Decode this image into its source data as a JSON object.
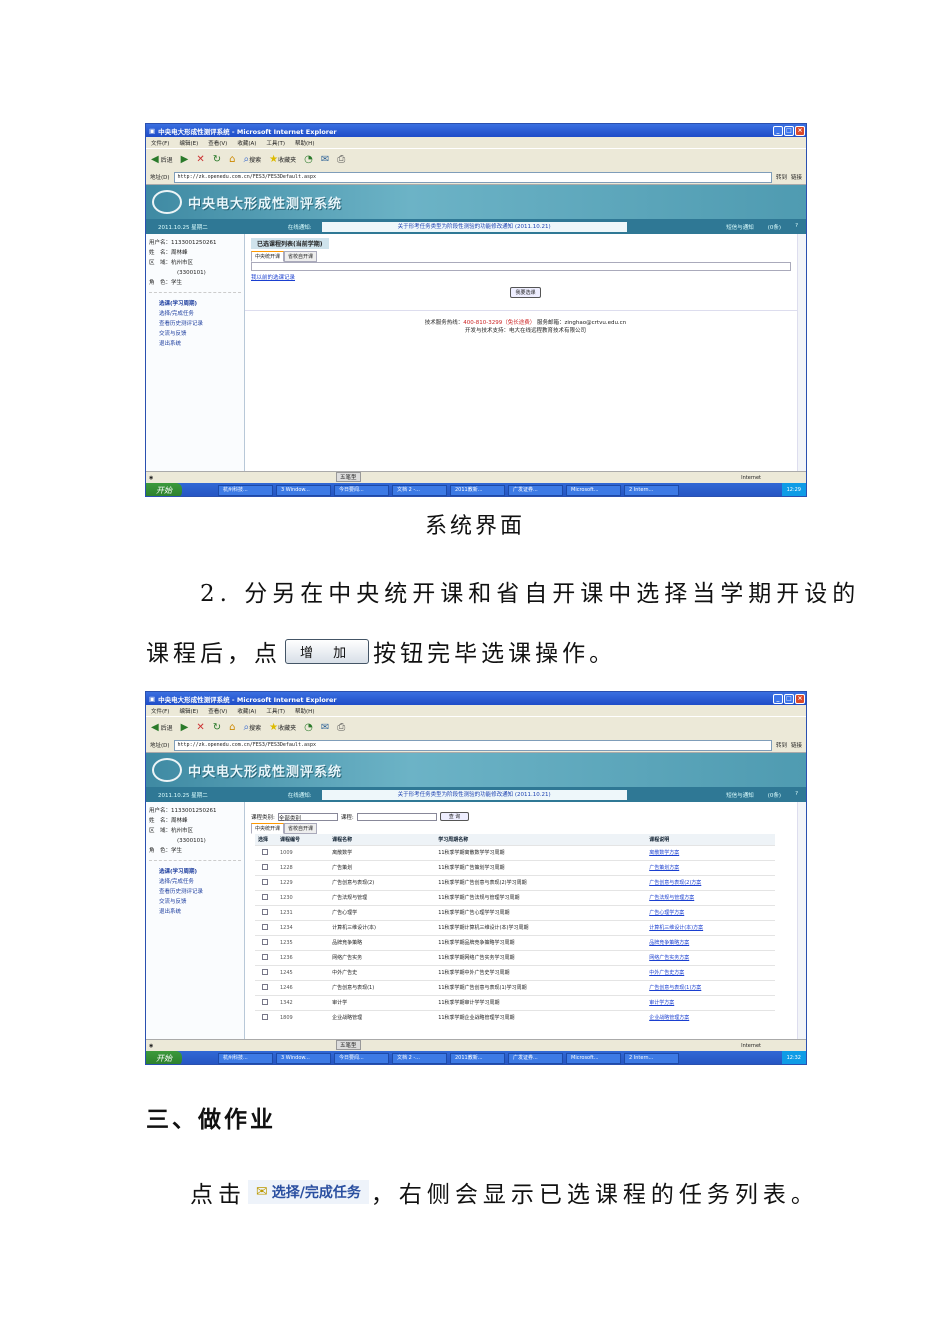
{
  "browser": {
    "window_title": "中央电大形成性测评系统 - Microsoft Internet Explorer",
    "menu": [
      "文件(F)",
      "编辑(E)",
      "查看(V)",
      "收藏(A)",
      "工具(T)",
      "帮助(H)"
    ],
    "toolbar": {
      "back": "后退",
      "search": "搜索",
      "favorites": "收藏夹"
    },
    "address_label": "地址(D)",
    "url": "http://zk.openedu.com.cn/FES3/FES3Default.aspx",
    "go": "转到",
    "links": "链接",
    "status_zone": "Internet",
    "ime": "五笔型"
  },
  "taskbar": {
    "start": "开始",
    "items": [
      "杭州科技...",
      "3 Window...",
      "今日要闻...",
      "文档 2 -...",
      "2011教新...",
      "广发证券...",
      "Microsoft...",
      "2 Intern..."
    ],
    "time1": "12:29",
    "time2": "12:32"
  },
  "app": {
    "system_title": "中央电大形成性测评系统",
    "date": "2011.10.25 星期二",
    "notice_label": "在线通知:",
    "notice": "关于形考任务类型为阶段性测验的功能修改通知 (2011.10.21)",
    "messages": "短信与通知",
    "msg_count": "(0条)",
    "user": {
      "username_label": "用户名：",
      "username": "1133001250261",
      "name_label": "姓　名：",
      "name": "周林峰",
      "region_label": "区　域：",
      "region": "杭州市区",
      "region_code": "(3300101)",
      "role_label": "角　色：",
      "role": "学生"
    },
    "nav": [
      "选课(学习周期)",
      "选择/完成任务",
      "查看历史测评记录",
      "交流与反馈",
      "退出系统"
    ]
  },
  "screen1": {
    "panel_title": "已选课程列表(当前学期)",
    "tabs": [
      "中央统开课",
      "省校自开课"
    ],
    "history_link": "我以前的选课记录",
    "select_button": "我要选课",
    "hotline_label": "技术服务热线：",
    "hotline": "400-810-3299（免长途费）",
    "email_label": "服务邮箱：",
    "email": "zinghao@crtvu.edu.cn",
    "support": "开发与技术支持：电大在线远程教育技术有限公司"
  },
  "screen2": {
    "category_label": "课程类别:",
    "category_value": "全部类别",
    "course_label": "课程:",
    "course_value": "",
    "query_button": "查 询",
    "tabs": [
      "中央统开课",
      "省校自开课"
    ],
    "columns": [
      "选择",
      "课程编号",
      "课程名称",
      "学习周期名称",
      "课程说明"
    ],
    "rows": [
      {
        "id": "1009",
        "name": "离散数学",
        "period": "11秋季学期离散数学学习周期",
        "plan": "离散数学方案"
      },
      {
        "id": "1228",
        "name": "广告策划",
        "period": "11秋季学期广告策划学习周期",
        "plan": "广告策划方案"
      },
      {
        "id": "1229",
        "name": "广告创意与表现(2)",
        "period": "11秋季学期广告创意与表现(2)学习周期",
        "plan": "广告创意与表现(2)方案"
      },
      {
        "id": "1230",
        "name": "广告法规与管理",
        "period": "11秋季学期广告法规与管理学习周期",
        "plan": "广告法规与管理方案"
      },
      {
        "id": "1231",
        "name": "广告心理学",
        "period": "11秋季学期广告心理学学习周期",
        "plan": "广告心理学方案"
      },
      {
        "id": "1234",
        "name": "计算机三维设计(本)",
        "period": "11秋季学期计算机三维设计(本)学习周期",
        "plan": "计算机三维设计(本)方案"
      },
      {
        "id": "1235",
        "name": "品牌竞争策略",
        "period": "11秋季学期品牌竞争策略学习周期",
        "plan": "品牌竞争策略方案"
      },
      {
        "id": "1236",
        "name": "网络广告实务",
        "period": "11秋季学期网络广告实务学习周期",
        "plan": "网络广告实务方案"
      },
      {
        "id": "1245",
        "name": "中外广告史",
        "period": "11秋季学期中外广告史学习周期",
        "plan": "中外广告史方案"
      },
      {
        "id": "1246",
        "name": "广告创意与表现(1)",
        "period": "11秋季学期广告创意与表现(1)学习周期",
        "plan": "广告创意与表现(1)方案"
      },
      {
        "id": "1342",
        "name": "审计学",
        "period": "11秋季学期审计学学习周期",
        "plan": "审计学方案"
      },
      {
        "id": "1809",
        "name": "企业战略管理",
        "period": "11秋季学期企业战略管理学习周期",
        "plan": "企业战略管理方案"
      }
    ]
  },
  "doc": {
    "caption": "系统界面",
    "step2_line1": "2. 分另在中央统开课和省自开课中选择当学期开设的",
    "step2_line2a": "课程后，点",
    "add_button": "增 加",
    "step2_line2b": "按钮完毕选课操作。",
    "section3": "三、做作业",
    "step3a": "点击",
    "step3_menu": "选择/完成任务",
    "step3b": "，右侧会显示已选课程的任务列表。"
  }
}
